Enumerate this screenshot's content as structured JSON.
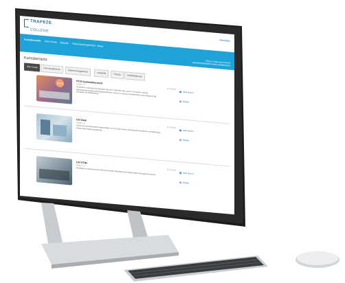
{
  "brand": {
    "name": "TRAPEZE",
    "sub": "COLLEGE"
  },
  "account": {
    "label": "Abmelden"
  },
  "nav": {
    "items": [
      "Kursübersicht",
      "Mein Konto",
      "Statistik",
      "Dokumentenspeicher",
      "News"
    ],
    "right_line1": "Trapeze Switzerland GmbH",
    "right_line2": "DEMOANWENDER DEMO-ANWENDER"
  },
  "page": {
    "title": "Kursübersicht"
  },
  "tabs": [
    "Alle Kurse",
    "Fahrzeugtheorie",
    "Datenmanagement",
    "Leitstelle",
    "Tickets",
    "Mobilitätskarte"
  ],
  "courses": [
    {
      "title": "ITCS Systemübersicht",
      "sub": "Version 1.0",
      "desc": "Im diesem e-Learning Kurs gelangen Sie einen Überblick über unser ITCS System und die Dokumentationsweise und Aufgabenbereiche. Dieses e-Learning vermittelt Basis und Leistung für die Konzepte und Arbeitsweisen.",
      "date": "21.11.2020",
      "action": "Jetzt lernen",
      "action2": "Details"
    },
    {
      "title": "LIO Data",
      "sub": "Version 1.0",
      "desc": "Lernen Sie die funktionalen Eigenschaften von LIO Data kennen. Die Benutzer-Oberfläche vermittelt Basis-Wissen über Datenmanagement.",
      "date": "23.11.2020",
      "action": "Jetzt lernen",
      "action2": "Details"
    },
    {
      "title": "LIO STIM",
      "sub": "Version 1.0",
      "desc": "Mit diesem e-Learning lernen Sie das Anwender-Oberfläche des Digital Station Management kennen.",
      "date": "20.11.2020",
      "action": "Jetzt lernen",
      "action2": "Details"
    }
  ],
  "colors": {
    "nav": "#1ea3d9",
    "brand": "#1a6aa0",
    "active_tab": "#4a4a4a"
  }
}
